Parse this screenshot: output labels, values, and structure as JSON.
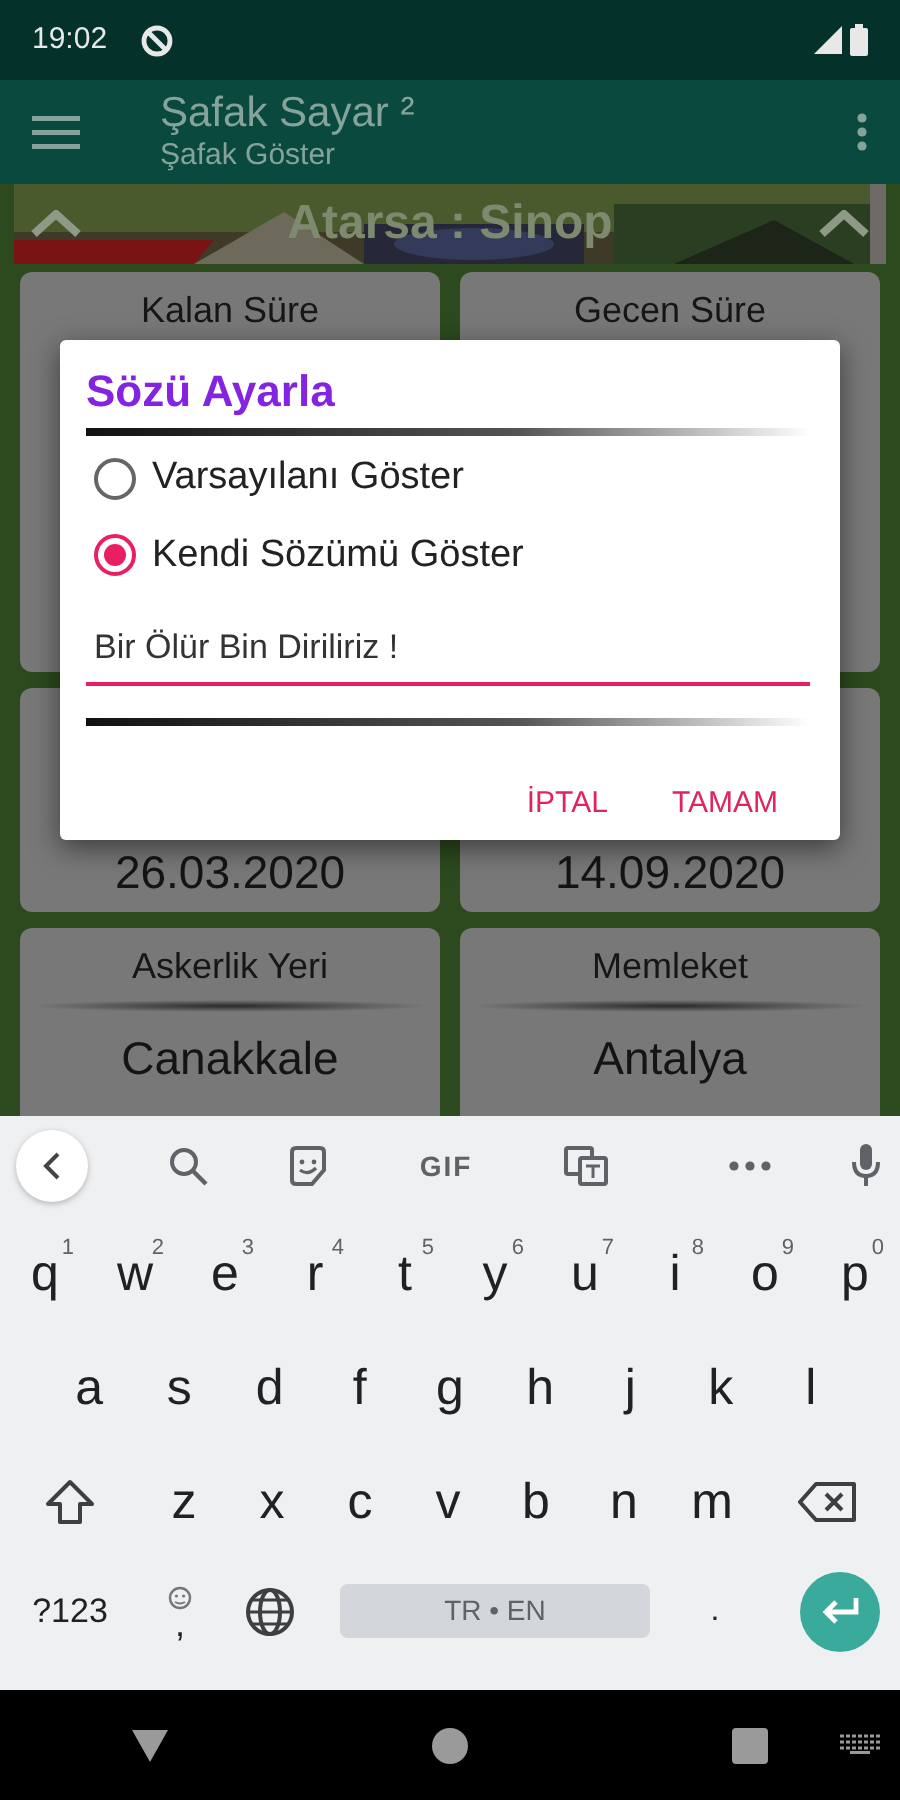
{
  "status_bar": {
    "time": "19:02"
  },
  "app_bar": {
    "title": "Şafak Sayar ²",
    "subtitle": "Şafak Göster"
  },
  "banner": {
    "text": "Atarsa : Sinop"
  },
  "cards": [
    {
      "label": "Kalan Süre"
    },
    {
      "label": "Gecen Süre"
    },
    {
      "value": "26.03.2020"
    },
    {
      "value": "14.09.2020"
    },
    {
      "label": "Askerlik Yeri",
      "value": "Canakkale"
    },
    {
      "label": "Memleket",
      "value": "Antalya"
    }
  ],
  "dialog": {
    "title": "Sözü Ayarla",
    "options": [
      {
        "label": "Varsayılanı Göster",
        "selected": false
      },
      {
        "label": "Kendi Sözümü Göster",
        "selected": true
      }
    ],
    "input": {
      "value": "Bir Ölür Bin Diriliriz !"
    },
    "buttons": [
      "İPTAL",
      "TAMAM"
    ]
  },
  "keyboard": {
    "gif": "GIF",
    "rows": [
      [
        "q",
        "w",
        "e",
        "r",
        "t",
        "y",
        "u",
        "i",
        "o",
        "p"
      ],
      [
        "a",
        "s",
        "d",
        "f",
        "g",
        "h",
        "j",
        "k",
        "l"
      ],
      [
        "z",
        "x",
        "c",
        "v",
        "b",
        "n",
        "m"
      ]
    ],
    "hints": [
      "1",
      "2",
      "3",
      "4",
      "5",
      "6",
      "7",
      "8",
      "9",
      "0"
    ],
    "symbols_key": "?123",
    "comma_key": ",",
    "space_key": "TR • EN",
    "period_key": "."
  }
}
